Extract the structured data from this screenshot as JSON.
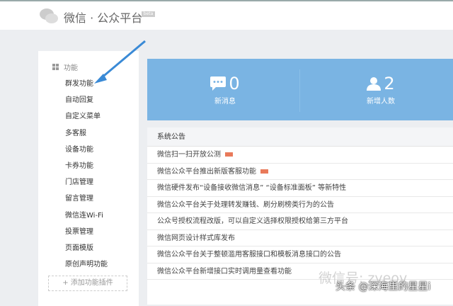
{
  "header": {
    "brand": "微信 · 公众平台",
    "beta": "beta"
  },
  "sidebar": {
    "section": "功能",
    "items": [
      "群发功能",
      "自动回复",
      "自定义菜单",
      "多客服",
      "设备功能",
      "卡券功能",
      "门店管理",
      "留言管理",
      "微信连Wi-Fi",
      "投票管理",
      "页面模版",
      "原创声明功能"
    ],
    "add_plugin": "+ 添加功能插件"
  },
  "stats": [
    {
      "value": "0",
      "label": "新消息"
    },
    {
      "value": "2",
      "label": "新增人数"
    }
  ],
  "notices": {
    "title": "系统公告",
    "items": [
      {
        "text": "微信扫一扫开放公测",
        "new": true
      },
      {
        "text": "微信公众平台推出新版客服功能",
        "new": true
      },
      {
        "text": "微信硬件发布“设备接收微信消息” “设备标准面板” 等新特性",
        "new": false
      },
      {
        "text": "微信公众平台关于处理转发赚钱、刷分刷榜类行为的公告",
        "new": false
      },
      {
        "text": "公众号授权流程改版，可以自定义选择权限授权给第三方平台",
        "new": false
      },
      {
        "text": "微信网页设计样式库发布",
        "new": false
      },
      {
        "text": "微信公众平台关于整顿滥用客服接口和模板消息接口的公告",
        "new": false
      },
      {
        "text": "微信公众平台新增接口实时调用量查看功能",
        "new": false
      }
    ]
  },
  "watermark": {
    "faded": "微信号: zyeov",
    "main": "头条 @深海里的星星i"
  },
  "colors": {
    "banner": "#7ab4e3",
    "arrow": "#3a8ad6",
    "new_badge": "#e97a5a"
  }
}
